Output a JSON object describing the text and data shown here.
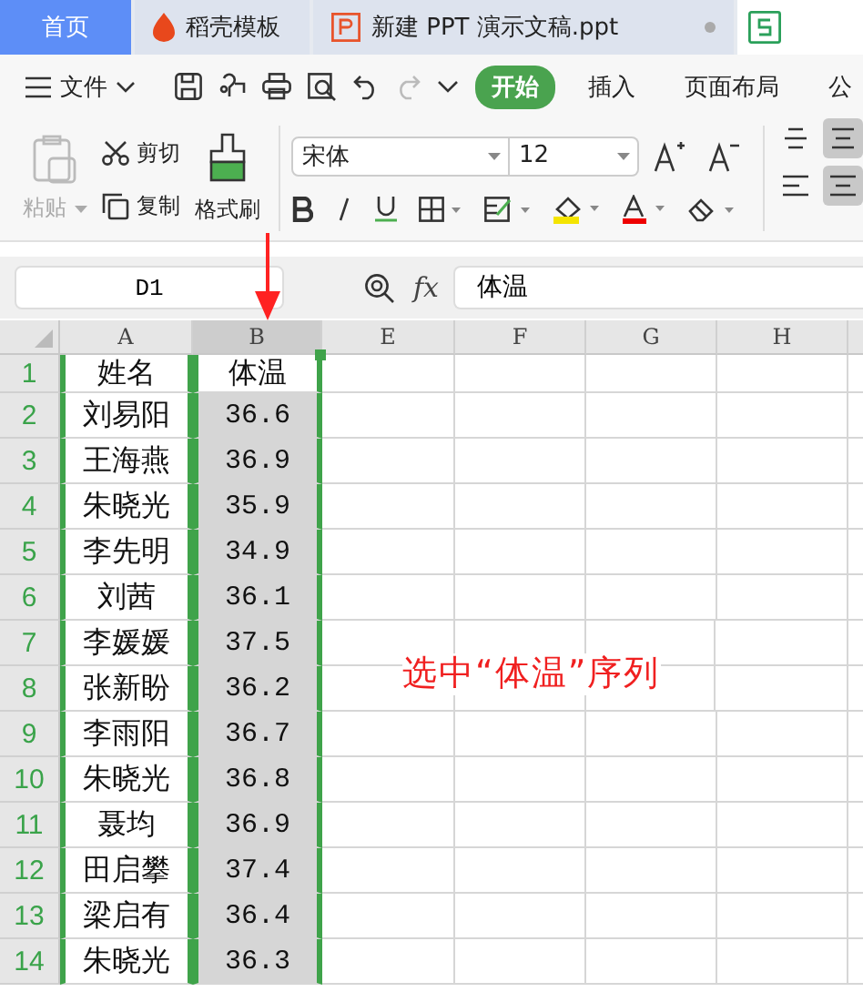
{
  "tabs": [
    {
      "kind": "home",
      "label": "首页",
      "selected": false
    },
    {
      "kind": "docer",
      "label": "稻壳模板",
      "selected": false
    },
    {
      "kind": "ppt",
      "label": "新建 PPT 演示文稿.ppt",
      "selected": false
    },
    {
      "kind": "sheet",
      "selected": true
    }
  ],
  "menu": {
    "file": "文件",
    "tabs": [
      {
        "label": "开始",
        "selected": true
      },
      {
        "label": "插入",
        "selected": false
      },
      {
        "label": "页面布局",
        "selected": false
      },
      {
        "label": "公",
        "selected": false
      }
    ]
  },
  "ribbon": {
    "paste": {
      "label": "粘贴",
      "disabled": true
    },
    "cut": "剪切",
    "copy": "复制",
    "format_painter": "格式刷",
    "font": "宋体",
    "size": "12",
    "alignment": [
      {
        "selected": false
      },
      {
        "selected": true
      },
      {
        "selected": false
      },
      {
        "selected": true
      }
    ]
  },
  "formula_bar": {
    "cell": "D1",
    "fx": "fx",
    "value": "体温"
  },
  "sheet": {
    "columns": [
      {
        "label": "A",
        "selected": false,
        "outlined": true
      },
      {
        "label": "B",
        "selected": true,
        "outlined": true
      },
      {
        "label": "E",
        "selected": false,
        "outlined": false
      },
      {
        "label": "F",
        "selected": false,
        "outlined": false
      },
      {
        "label": "G",
        "selected": false,
        "outlined": false
      },
      {
        "label": "H",
        "selected": false,
        "outlined": false
      }
    ],
    "rows": [
      {
        "number": "1",
        "name": "姓名",
        "temperature": "体温",
        "active": true
      },
      {
        "number": "2",
        "name": "刘易阳",
        "temperature": "36.6",
        "active": false
      },
      {
        "number": "3",
        "name": "王海燕",
        "temperature": "36.9",
        "active": false
      },
      {
        "number": "4",
        "name": "朱晓光",
        "temperature": "35.9",
        "active": false
      },
      {
        "number": "5",
        "name": "李先明",
        "temperature": "34.9",
        "active": false
      },
      {
        "number": "6",
        "name": "刘茜",
        "temperature": "36.1",
        "active": false
      },
      {
        "number": "7",
        "name": "李媛媛",
        "temperature": "37.5",
        "active": false
      },
      {
        "number": "8",
        "name": "张新盼",
        "temperature": "36.2",
        "active": false
      },
      {
        "number": "9",
        "name": "李雨阳",
        "temperature": "36.7",
        "active": false
      },
      {
        "number": "10",
        "name": "朱晓光",
        "temperature": "36.8",
        "active": false
      },
      {
        "number": "11",
        "name": "聂均",
        "temperature": "36.9",
        "active": false
      },
      {
        "number": "12",
        "name": "田启攀",
        "temperature": "37.4",
        "active": false
      },
      {
        "number": "13",
        "name": "梁启有",
        "temperature": "36.4",
        "active": false
      },
      {
        "number": "14",
        "name": "朱晓光",
        "temperature": "36.3",
        "active": false
      }
    ]
  },
  "annotation": {
    "text": "选中“体温”序列"
  }
}
